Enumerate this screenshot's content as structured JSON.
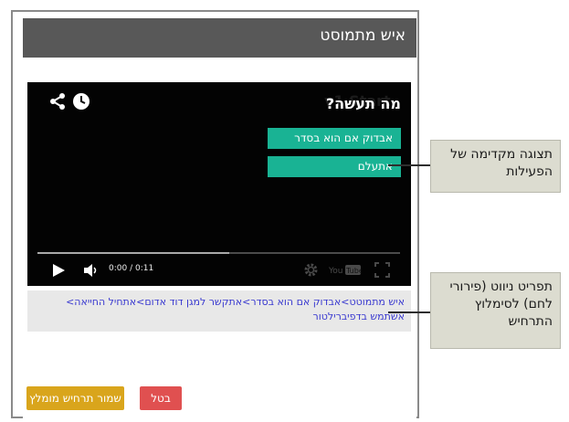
{
  "dialog": {
    "title": "איש מתמוסט"
  },
  "video": {
    "ghost_text": "v1 Start",
    "question": "מה תעשה?",
    "choices": [
      {
        "label": "אבדוק אם הוא בסדר"
      },
      {
        "label": "אתעלם"
      }
    ],
    "time": "0:00 / 0:11",
    "progress": 0.53
  },
  "breadcrumb": "איש מתמוטט>אבדוק אם הוא בסדר>אתקשר למגן דוד אדום>אתחיל החייאה> אשתמש בדפיברילטור",
  "buttons": {
    "cancel": "בטל",
    "save": "שמור תרחיש מומלץ"
  },
  "callouts": {
    "preview": "תצוגה מקדימה של הפעילות",
    "breadcrumb_help": "תפריט ניווט (פירורי לחם) לסימלוץ התרחיש"
  },
  "colors": {
    "titlebar": "#585858",
    "choice": "#19b394",
    "save": "#d9a51c",
    "cancel": "#e05050",
    "link": "#3a3ad0"
  }
}
